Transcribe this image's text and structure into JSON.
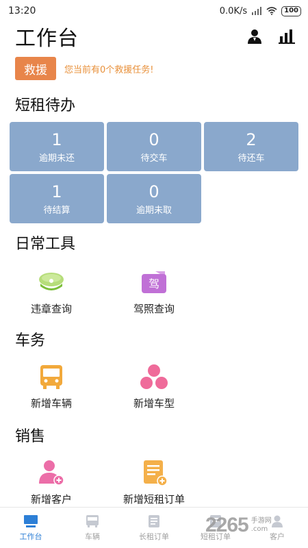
{
  "status_bar": {
    "time": "13:20",
    "speed": "0.0K/s",
    "battery": "100"
  },
  "header": {
    "title": "工作台",
    "user_icon": "user-icon",
    "stats_icon": "bar-chart-icon"
  },
  "rescue": {
    "button_label": "救援",
    "message": "您当前有0个救援任务!"
  },
  "short_rent_pending": {
    "title": "短租待办",
    "tiles": [
      {
        "count": "1",
        "label": "逾期未还"
      },
      {
        "count": "0",
        "label": "待交车"
      },
      {
        "count": "2",
        "label": "待还车"
      },
      {
        "count": "1",
        "label": "待结算"
      },
      {
        "count": "0",
        "label": "逾期未取"
      }
    ]
  },
  "daily_tools": {
    "title": "日常工具",
    "items": [
      {
        "label": "违章查询",
        "icon": "police-cap-icon"
      },
      {
        "label": "驾照查询",
        "icon": "license-icon",
        "icon_text": "驾"
      }
    ]
  },
  "vehicle_affairs": {
    "title": "车务",
    "items": [
      {
        "label": "新增车辆",
        "icon": "bus-icon"
      },
      {
        "label": "新增车型",
        "icon": "circles-icon"
      }
    ]
  },
  "sales": {
    "title": "销售",
    "items": [
      {
        "label": "新增客户",
        "icon": "add-customer-icon"
      },
      {
        "label": "新增短租订单",
        "icon": "add-order-icon"
      }
    ]
  },
  "bottom_nav": {
    "items": [
      {
        "label": "工作台",
        "icon": "monitor-icon",
        "active": true
      },
      {
        "label": "车辆",
        "icon": "vehicle-icon"
      },
      {
        "label": "长租订单",
        "icon": "long-order-icon"
      },
      {
        "label": "短租订单",
        "icon": "short-order-icon"
      },
      {
        "label": "客户",
        "icon": "customer-icon"
      }
    ]
  },
  "watermark": {
    "number": "2265",
    "domain": ".com",
    "brand": "手游网"
  },
  "colors": {
    "tile": "#8aa8cc",
    "rescue": "#e8854a",
    "active_nav": "#2d7fd6"
  }
}
